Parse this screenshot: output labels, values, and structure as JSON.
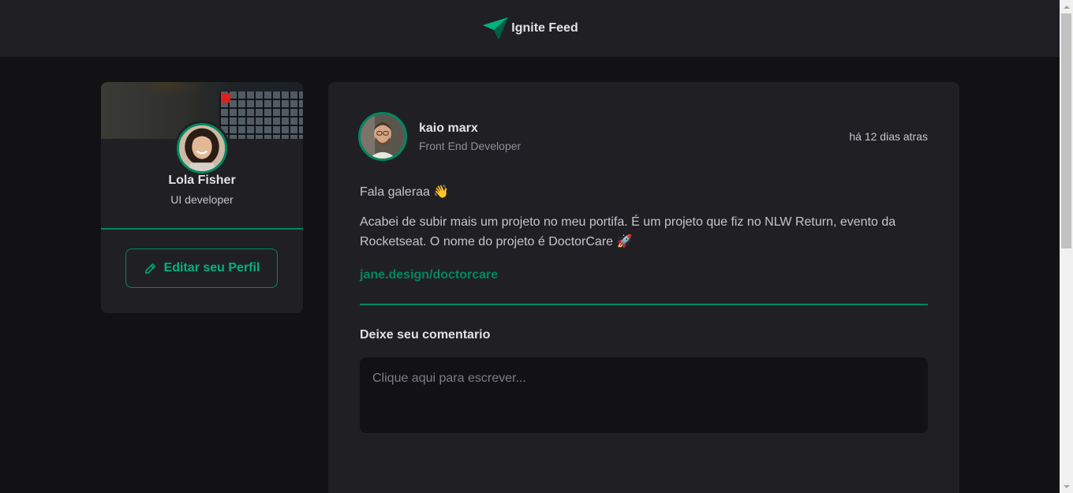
{
  "header": {
    "title": "Ignite Feed",
    "logo_icon": "paper-plane-logo-icon",
    "accent": "#00B37E"
  },
  "sidebar": {
    "profile": {
      "name": "Lola Fisher",
      "role": "UI developer"
    },
    "edit_button_label": "Editar seu Perfil",
    "edit_icon": "pencil-icon"
  },
  "post": {
    "author": {
      "name": "kaio marx",
      "role": "Front End Developer"
    },
    "published": "há 12 dias atras",
    "content": {
      "greeting": "Fala galeraa 👋",
      "body": "Acabei de subir mais um projeto no meu portifa. É um projeto que fiz no NLW Return, evento da Rocketseat. O nome do projeto é DoctorCare 🚀",
      "link": "jane.design/doctorcare"
    },
    "comment_form": {
      "title": "Deixe seu comentario",
      "placeholder": "Clique aqui para escrever..."
    }
  },
  "colors": {
    "background": "#121214",
    "surface": "#202024",
    "green": "#00875F",
    "green_light": "#00B37E"
  }
}
